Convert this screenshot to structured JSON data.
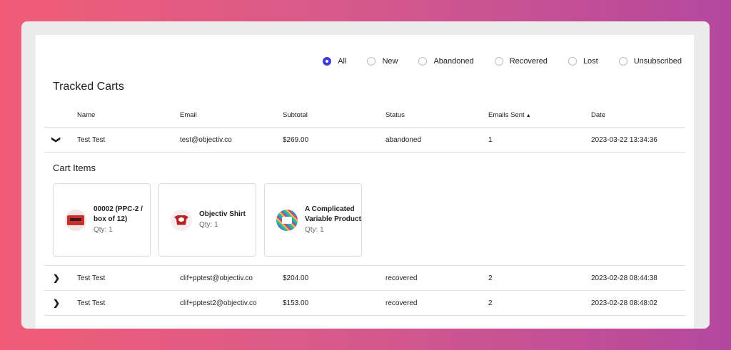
{
  "filters": [
    {
      "label": "All",
      "checked": true
    },
    {
      "label": "New",
      "checked": false
    },
    {
      "label": "Abandoned",
      "checked": false
    },
    {
      "label": "Recovered",
      "checked": false
    },
    {
      "label": "Lost",
      "checked": false
    },
    {
      "label": "Unsubscribed",
      "checked": false
    }
  ],
  "title": "Tracked Carts",
  "columns": {
    "name": "Name",
    "email": "Email",
    "subtotal": "Subtotal",
    "status": "Status",
    "emails_sent": "Emails Sent",
    "sort_indicator": "▲",
    "date": "Date"
  },
  "rows": [
    {
      "name": "Test Test",
      "email": "test@objectiv.co",
      "subtotal": "$269.00",
      "status": "abandoned",
      "emails_sent": "1",
      "date": "2023-03-22 13:34:36",
      "expanded": true
    },
    {
      "name": "Test Test",
      "email": "clif+pptest@objectiv.co",
      "subtotal": "$204.00",
      "status": "recovered",
      "emails_sent": "2",
      "date": "2023-02-28 08:44:38",
      "expanded": false
    },
    {
      "name": "Test Test",
      "email": "clif+pptest2@objectiv.co",
      "subtotal": "$153.00",
      "status": "recovered",
      "emails_sent": "2",
      "date": "2023-02-28 08:48:02",
      "expanded": false
    }
  ],
  "cart_items": {
    "title": "Cart Items",
    "items": [
      {
        "name": "00002 (PPC-2 / box of 12)",
        "qty": "Qty: 1"
      },
      {
        "name": "Objectiv Shirt",
        "qty": "Qty: 1"
      },
      {
        "name": "A Complicated Variable Product",
        "qty": "Qty: 1"
      }
    ]
  },
  "icons": {
    "expanded": "chevron-down-icon",
    "collapsed": "chevron-right-icon"
  },
  "colors": {
    "accent": "#3c3cd8",
    "background_start": "#f25c77",
    "background_end": "#b4489e"
  }
}
